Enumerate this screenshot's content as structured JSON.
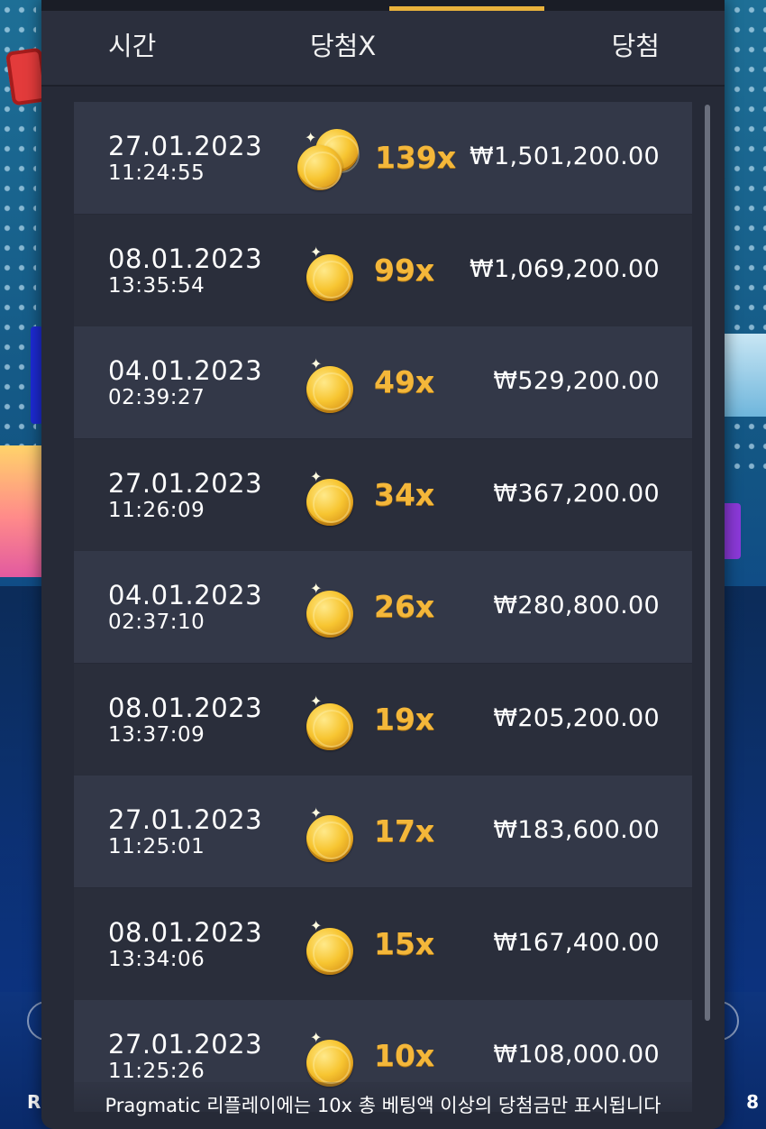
{
  "header": {
    "col_time": "시간",
    "col_multiplier": "당첨X",
    "col_win": "당첨"
  },
  "rows": [
    {
      "date": "27.01.2023",
      "time": "11:24:55",
      "multiplier": "139x",
      "amount": "₩1,501,200.00",
      "coins": 2
    },
    {
      "date": "08.01.2023",
      "time": "13:35:54",
      "multiplier": "99x",
      "amount": "₩1,069,200.00",
      "coins": 1
    },
    {
      "date": "04.01.2023",
      "time": "02:39:27",
      "multiplier": "49x",
      "amount": "₩529,200.00",
      "coins": 1
    },
    {
      "date": "27.01.2023",
      "time": "11:26:09",
      "multiplier": "34x",
      "amount": "₩367,200.00",
      "coins": 1
    },
    {
      "date": "04.01.2023",
      "time": "02:37:10",
      "multiplier": "26x",
      "amount": "₩280,800.00",
      "coins": 1
    },
    {
      "date": "08.01.2023",
      "time": "13:37:09",
      "multiplier": "19x",
      "amount": "₩205,200.00",
      "coins": 1
    },
    {
      "date": "27.01.2023",
      "time": "11:25:01",
      "multiplier": "17x",
      "amount": "₩183,600.00",
      "coins": 1
    },
    {
      "date": "08.01.2023",
      "time": "13:34:06",
      "multiplier": "15x",
      "amount": "₩167,400.00",
      "coins": 1
    },
    {
      "date": "27.01.2023",
      "time": "11:25:26",
      "multiplier": "10x",
      "amount": "₩108,000.00",
      "coins": 1
    }
  ],
  "footer": {
    "note": "Pragmatic 리플레이에는 10x 총 베팅액 이상의 당첨금만 표시됩니다"
  },
  "background": {
    "left_fragment": "R",
    "right_fragment": "8"
  },
  "colors": {
    "panel": "#262a37",
    "row_light": "#333848",
    "row_dark": "#2a2e3b",
    "accent": "#e9b23c",
    "multiplier": "#f4b73a"
  },
  "icons": {
    "coin": "gold-coin-icon",
    "coin_stack": "gold-coin-stack-icon"
  }
}
